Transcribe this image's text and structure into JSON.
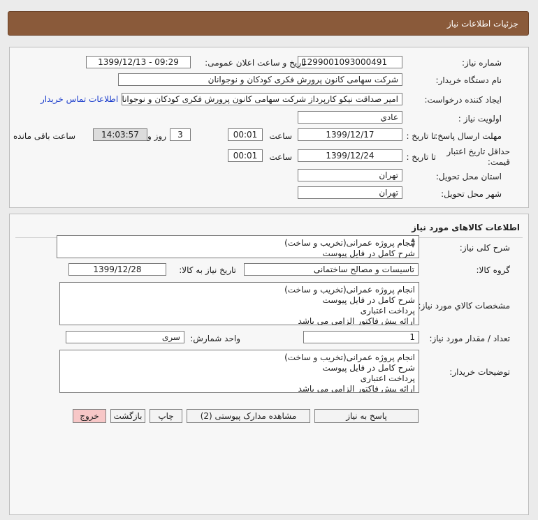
{
  "header": {
    "title": "جزئیات اطلاعات نیاز"
  },
  "details": {
    "need_number_label": "شماره نیاز:",
    "need_number": "1299001093000491",
    "announce_label": "تاریخ و ساعت اعلان عمومی:",
    "announce_value": "1399/12/13 - 09:29",
    "buyer_org_label": "نام دستگاه خریدار:",
    "buyer_org": "شرکت سهامی کانون پرورش فکری کودکان و نوجوانان",
    "requester_label": "ایجاد کننده درخواست:",
    "requester": "امیر صداقت نیکو کارپرداز شرکت سهامی کانون پرورش فکری کودکان و نوجوانان",
    "contact_link": "اطلاعات تماس خریدار",
    "priority_label": "اولویت نیاز :",
    "priority": "عادي",
    "deadline_label": "مهلت ارسال پاسخ:",
    "to_date_label": "تا تاریخ :",
    "deadline_date": "1399/12/17",
    "time_label": "ساعت",
    "deadline_time": "00:01",
    "days_value": "3",
    "days_label": "روز و",
    "remaining_time": "14:03:57",
    "remaining_label": "ساعت باقی مانده",
    "validity_label": "حداقل تاریخ اعتبار قیمت:",
    "validity_to_label": "تا تاریخ :",
    "validity_date": "1399/12/24",
    "validity_time_label": "ساعت",
    "validity_time": "00:01",
    "province_label": "استان محل تحویل:",
    "province": "تهران",
    "city_label": "شهر محل تحویل:",
    "city": "تهران"
  },
  "goods": {
    "section_title": "اطلاعات کالاهای مورد نیاز",
    "general_desc_label": "شرح کلی نیاز:",
    "general_desc": "انجام پروژه عمرانی(تخریب و ساخت)\nشرح کامل در فایل پیوست",
    "group_label": "گروه کالا:",
    "group_value": "تاسیسات و مصالح ساختمانی",
    "need_date_label": "تاریخ نیاز به کالا:",
    "need_date": "1399/12/28",
    "specs_label": "مشخصات کالاي مورد نياز:",
    "specs": "انجام پروژه عمرانی(تخریب و ساخت)\nشرح کامل در فایل پیوست\nپرداخت اعتباری\nارائه پیش فاکتور الزامی می باشد",
    "qty_label": "تعداد / مقدار مورد نیاز:",
    "qty": "1",
    "unit_label": "واحد شمارش:",
    "unit": "سری",
    "buyer_notes_label": "توضیحات خریدار:",
    "buyer_notes": "انجام پروژه عمرانی(تخریب و ساخت)\nشرح کامل در فایل پیوست\nپرداخت اعتباری\nارائه پیش فاکتور الزامی می باشد"
  },
  "buttons": {
    "reply": "پاسخ به نیاز",
    "view_docs": "مشاهده مدارک پیوستی (2)",
    "print": "چاپ",
    "back": "بازگشت",
    "exit": "خروج"
  },
  "colors": {
    "header_bg": "#8a5a3a",
    "exit_bg": "#f7c7c7",
    "link": "#1a3ccc"
  }
}
